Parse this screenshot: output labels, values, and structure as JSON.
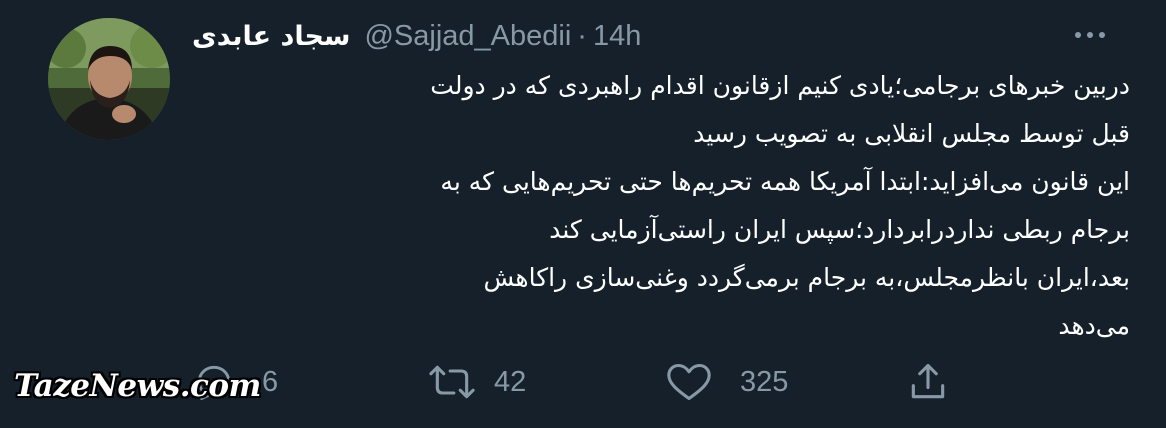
{
  "tweet": {
    "display_name": "سجاد عابدی",
    "handle": "@Sajjad_Abedii",
    "separator": "·",
    "time": "14h",
    "body_lines": [
      "دربین خبرهای برجامی؛یادی کنیم ازقانون اقدام راهبردی که در دولت",
      "قبل توسط مجلس انقلابی به تصویب رسید",
      "این قانون می‌افزاید:ابتدا آمریکا همه تحریم‌ها حتی تحریم‌هایی که به",
      "برجام ربطی نداردرابردارد؛سپس ایران راستی‌آزمایی کند",
      "بعد،ایران بانظرمجلس،به برجام برمی‌گردد وغنی‌سازی راکاهش",
      "می‌دهد"
    ]
  },
  "actions": {
    "reply_count": "6",
    "retweet_count": "42",
    "like_count": "325"
  },
  "icons": {
    "reply": "reply-icon",
    "retweet": "retweet-icon",
    "like": "heart-icon",
    "share": "share-icon",
    "more": "more-icon"
  },
  "watermark": "TazeNews.com",
  "colors": {
    "background": "#15202b",
    "text": "#ffffff",
    "secondary": "#8899a6"
  }
}
